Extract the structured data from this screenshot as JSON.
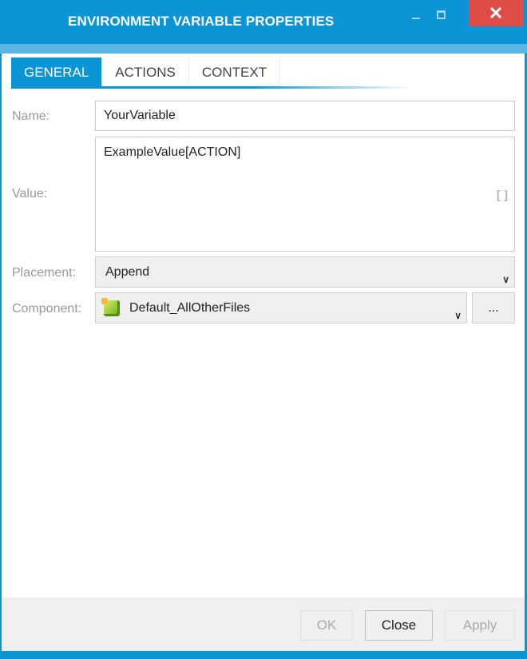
{
  "window": {
    "title": "ENVIRONMENT VARIABLE PROPERTIES",
    "minimize_icon": "minimize-icon",
    "maximize_icon": "maximize-icon",
    "close_glyph": "✕",
    "accent": "#0b95d6",
    "close_color": "#e04c48"
  },
  "tabs": [
    {
      "label": "GENERAL",
      "active": true
    },
    {
      "label": "ACTIONS"
    },
    {
      "label": "CONTEXT"
    }
  ],
  "form": {
    "name_label": "Name:",
    "name_value": "YourVariable",
    "value_label": "Value:",
    "value_value": "ExampleValue[ACTION]",
    "value_bracket_hint": "[ ]",
    "placement_label": "Placement:",
    "placement_value": "Append",
    "component_label": "Component:",
    "component_value": "Default_AllOtherFiles",
    "component_icon": "component-cube-icon",
    "browse_label": "..."
  },
  "footer": {
    "ok": "OK",
    "close": "Close",
    "apply": "Apply"
  }
}
